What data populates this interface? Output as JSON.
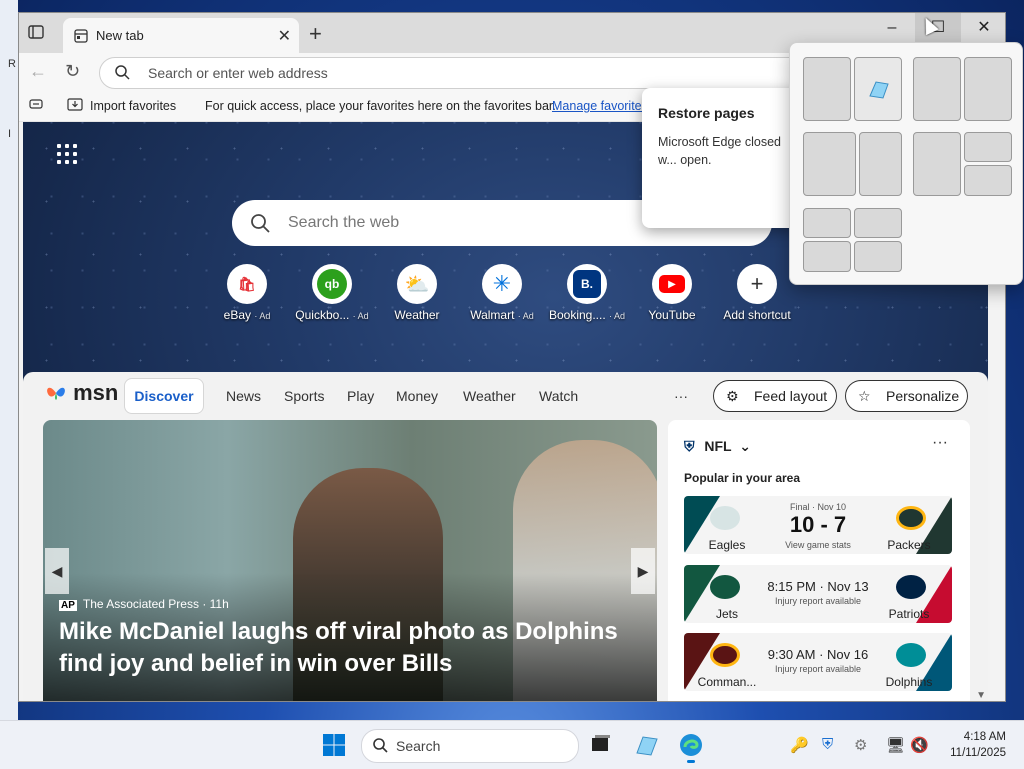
{
  "desktop": {
    "edge_letters": [
      "R",
      "I"
    ]
  },
  "browser": {
    "tab_title": "New tab",
    "address_placeholder": "Search or enter web address",
    "window_controls": {
      "minimize": "–",
      "maximize": "☐",
      "close": "✕"
    },
    "favorites_bar": {
      "import": "Import favorites",
      "prompt": "For quick access, place your favorites here on the favorites bar.",
      "manage_link": "Manage favorites"
    }
  },
  "newtab": {
    "search_placeholder": "Search the web",
    "shortcuts": [
      {
        "label": "eBay",
        "ad": "· Ad",
        "icon": "ebay-icon",
        "glyph": "🛍",
        "color": "#e53238"
      },
      {
        "label": "Quickbo...",
        "ad": "· Ad",
        "icon": "quickbooks-icon",
        "glyph": "qb",
        "color": "#2ca01c"
      },
      {
        "label": "Weather",
        "ad": "",
        "icon": "weather-icon",
        "glyph": "⛅",
        "color": "#f0a020"
      },
      {
        "label": "Walmart",
        "ad": "· Ad",
        "icon": "walmart-icon",
        "glyph": "✳",
        "color": "#0071dc"
      },
      {
        "label": "Booking....",
        "ad": "· Ad",
        "icon": "booking-icon",
        "glyph": "B.",
        "color": "#003580"
      },
      {
        "label": "YouTube",
        "ad": "",
        "icon": "youtube-icon",
        "glyph": "▶",
        "color": "#ff0000"
      },
      {
        "label": "Add shortcut",
        "ad": "",
        "icon": "add-icon",
        "glyph": "+",
        "color": "#333333"
      }
    ]
  },
  "restore_popup": {
    "title": "Restore pages",
    "body": "Microsoft Edge closed w... open."
  },
  "msn": {
    "logo": "msn",
    "tabs": [
      "Discover",
      "News",
      "Sports",
      "Play",
      "Money",
      "Weather",
      "Watch",
      "···"
    ],
    "feed_layout": "Feed layout",
    "personalize": "Personalize",
    "hero": {
      "source": "The Associated Press",
      "source_badge": "AP",
      "age": "· 11h",
      "headline": "Mike McDaniel laughs off viral photo as Dolphins find joy and belief in win over Bills"
    },
    "nfl": {
      "title": "NFL",
      "subtitle": "Popular in your area",
      "games": [
        {
          "left": "Eagles",
          "right": "Packers",
          "status": "Final · Nov 10",
          "score": "10 - 7",
          "note": "View game stats",
          "lcolor": "#004c54",
          "rcolor": "#203731"
        },
        {
          "left": "Jets",
          "right": "Patriots",
          "status": "8:15 PM · Nov 13",
          "score": "",
          "note": "Injury report available",
          "lcolor": "#125740",
          "rcolor": "#c60c30"
        },
        {
          "left": "Comman...",
          "right": "Dolphins",
          "status": "9:30 AM · Nov 16",
          "score": "",
          "note": "Injury report available",
          "lcolor": "#5a1414",
          "rcolor": "#005778"
        }
      ]
    }
  },
  "taskbar": {
    "search_label": "Search",
    "time": "4:18 AM",
    "date": "11/11/2025"
  }
}
